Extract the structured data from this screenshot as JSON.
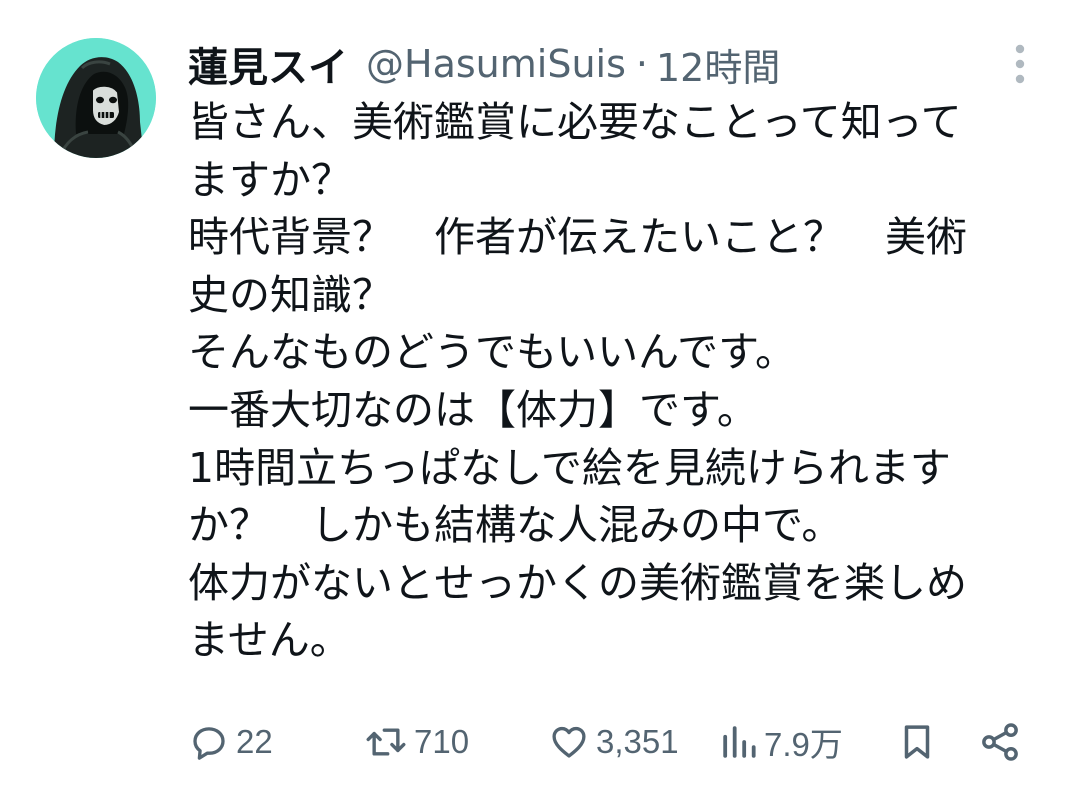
{
  "author": {
    "display_name": "蓮見スイ",
    "handle": "@HasumiSuis",
    "separator": "·",
    "time": "12時間",
    "avatar_icon": "hooded-figure-avatar"
  },
  "tweet": {
    "lines": [
      "皆さん、美術鑑賞に必要なことって知って",
      "ますか？",
      "時代背景？　作者が伝えたいこと？　美術",
      "史の知識？",
      "そんなものどうでもいいんです。",
      "一番大切なのは【体力】です。",
      "1時間立ちっぱなしで絵を見続けられます",
      "か？　しかも結構な人混みの中で。",
      "体力がないとせっかくの美術鑑賞を楽しめ",
      "ません。"
    ]
  },
  "actions": {
    "reply_count": "22",
    "retweet_count": "710",
    "like_count": "3,351",
    "view_count": "7.9万",
    "icons": [
      "reply-icon",
      "retweet-icon",
      "like-icon",
      "views-icon",
      "bookmark-icon",
      "share-icon"
    ]
  },
  "colors": {
    "text": "#0f1419",
    "secondary": "#536471",
    "avatar_bg": "#66e3cf"
  }
}
